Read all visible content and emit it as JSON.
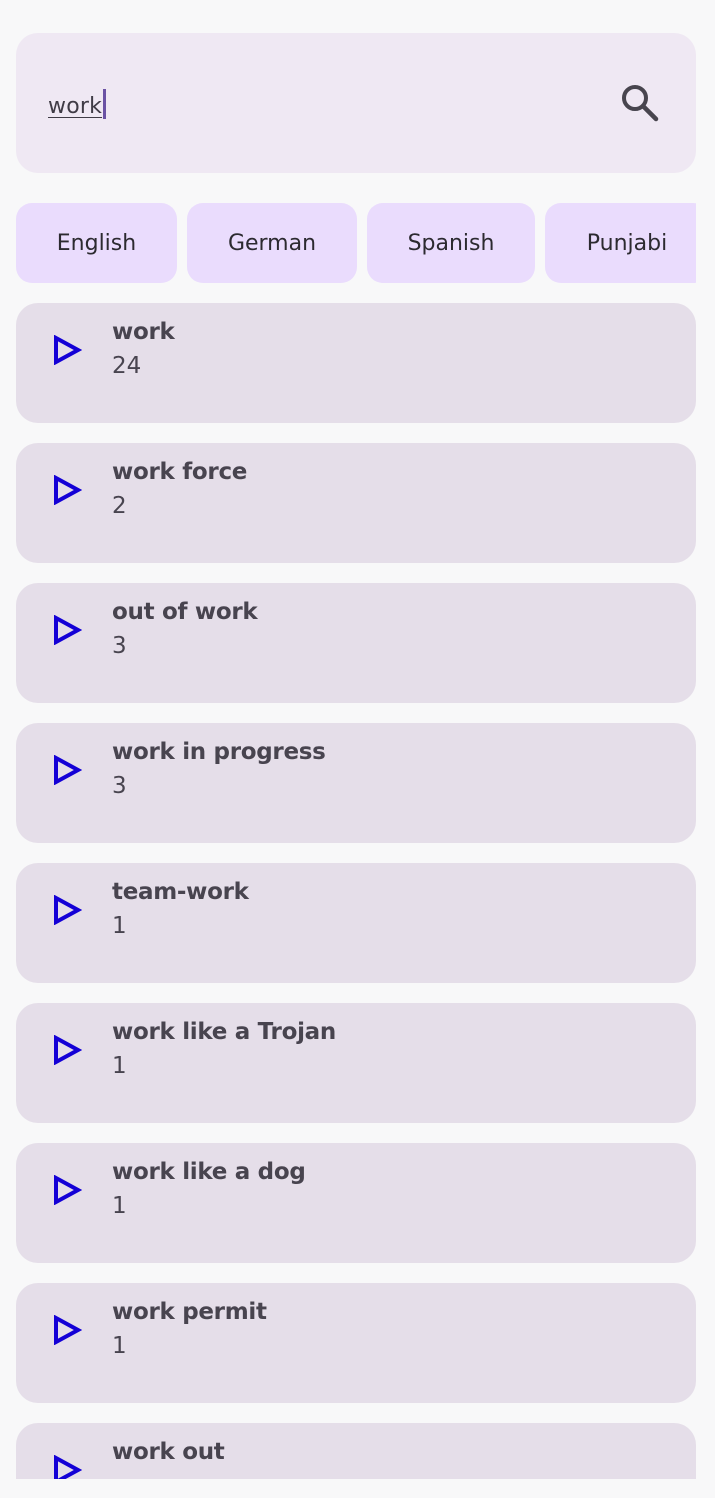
{
  "search": {
    "query": "work"
  },
  "languages": [
    "English",
    "German",
    "Spanish",
    "Punjabi"
  ],
  "results": [
    {
      "term": "work",
      "count": "24"
    },
    {
      "term": "work force",
      "count": "2"
    },
    {
      "term": "out of work",
      "count": "3"
    },
    {
      "term": "work in progress",
      "count": "3"
    },
    {
      "term": "team-work",
      "count": "1"
    },
    {
      "term": "work like a Trojan",
      "count": "1"
    },
    {
      "term": "work like a dog",
      "count": "1"
    },
    {
      "term": "work permit",
      "count": "1"
    },
    {
      "term": "work out",
      "count": ""
    }
  ],
  "colors": {
    "play_icon": "#1400d6",
    "chip_bg": "#eadcfd",
    "row_bg": "#e5dee9",
    "search_bg": "#efe8f3"
  }
}
